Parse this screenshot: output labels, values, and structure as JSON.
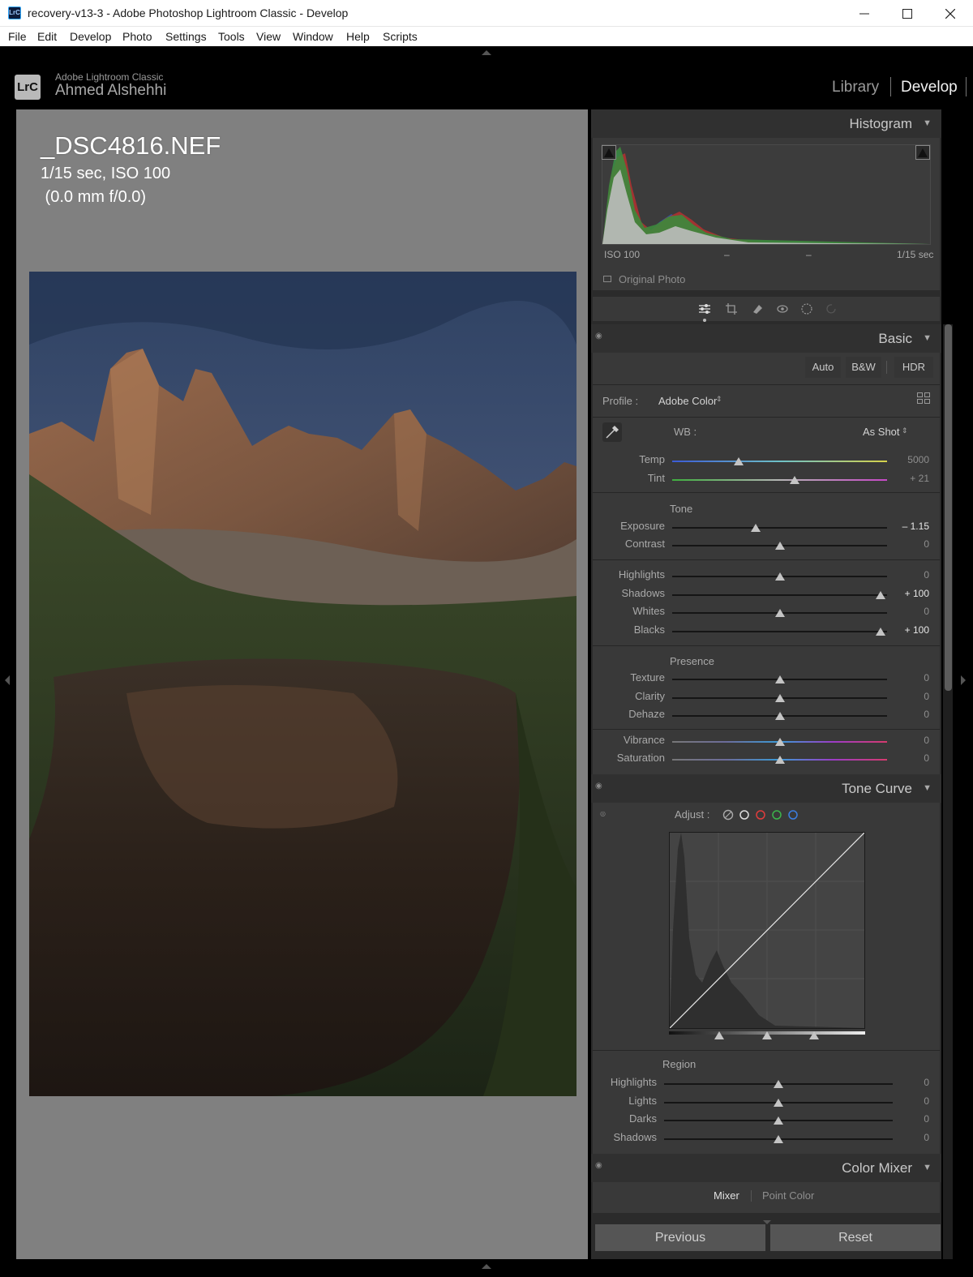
{
  "window": {
    "title": "recovery-v13-3 - Adobe Photoshop Lightroom Classic - Develop",
    "app_icon_text": "LrC"
  },
  "menu": [
    "File",
    "Edit",
    "Develop",
    "Photo",
    "Settings",
    "Tools",
    "View",
    "Window",
    "Help",
    "Scripts"
  ],
  "identity": {
    "badge": "LrC",
    "app_name": "Adobe Lightroom Classic",
    "user_name": "Ahmed Alshehhi"
  },
  "modules": {
    "library": "Library",
    "develop": "Develop"
  },
  "photo_info": {
    "file_name": "_DSC4816.NEF",
    "exposure_line": "1/15 sec, ISO 100",
    "lens_line": " (0.0 mm f/0.0)"
  },
  "histogram": {
    "title": "Histogram",
    "iso": "ISO 100",
    "focal": "–",
    "aperture": "–",
    "shutter": "1/15 sec",
    "original_photo": "Original Photo"
  },
  "basic": {
    "title": "Basic",
    "auto": "Auto",
    "bw": "B&W",
    "hdr": "HDR",
    "profile_label": "Profile :",
    "profile_value": "Adobe Color",
    "wb_label": "WB :",
    "wb_value": "As Shot",
    "tone_label": "Tone",
    "presence_label": "Presence",
    "sliders": {
      "temp": {
        "label": "Temp",
        "value": "5000",
        "pos": 0.31
      },
      "tint": {
        "label": "Tint",
        "value": "+ 21",
        "pos": 0.57
      },
      "exposure": {
        "label": "Exposure",
        "value": "– 1.15",
        "pos": 0.39
      },
      "contrast": {
        "label": "Contrast",
        "value": "0",
        "pos": 0.5
      },
      "highlights": {
        "label": "Highlights",
        "value": "0",
        "pos": 0.5
      },
      "shadows": {
        "label": "Shadows",
        "value": "+ 100",
        "pos": 0.97
      },
      "whites": {
        "label": "Whites",
        "value": "0",
        "pos": 0.5
      },
      "blacks": {
        "label": "Blacks",
        "value": "+ 100",
        "pos": 0.97
      },
      "texture": {
        "label": "Texture",
        "value": "0",
        "pos": 0.5
      },
      "clarity": {
        "label": "Clarity",
        "value": "0",
        "pos": 0.5
      },
      "dehaze": {
        "label": "Dehaze",
        "value": "0",
        "pos": 0.5
      },
      "vibrance": {
        "label": "Vibrance",
        "value": "0",
        "pos": 0.5
      },
      "saturation": {
        "label": "Saturation",
        "value": "0",
        "pos": 0.5
      }
    }
  },
  "tone_curve": {
    "title": "Tone Curve",
    "adjust_label": "Adjust :",
    "region_label": "Region",
    "sliders": {
      "highlights": {
        "label": "Highlights",
        "value": "0",
        "pos": 0.5
      },
      "lights": {
        "label": "Lights",
        "value": "0",
        "pos": 0.5
      },
      "darks": {
        "label": "Darks",
        "value": "0",
        "pos": 0.5
      },
      "shadows": {
        "label": "Shadows",
        "value": "0",
        "pos": 0.5
      }
    }
  },
  "color_mixer": {
    "title": "Color Mixer",
    "tab_mixer": "Mixer",
    "tab_point_color": "Point Color"
  },
  "footer": {
    "previous": "Previous",
    "reset": "Reset"
  },
  "colors": {
    "accent": "#f2f2f2",
    "panel": "#2b2b2b",
    "section": "#393939"
  }
}
